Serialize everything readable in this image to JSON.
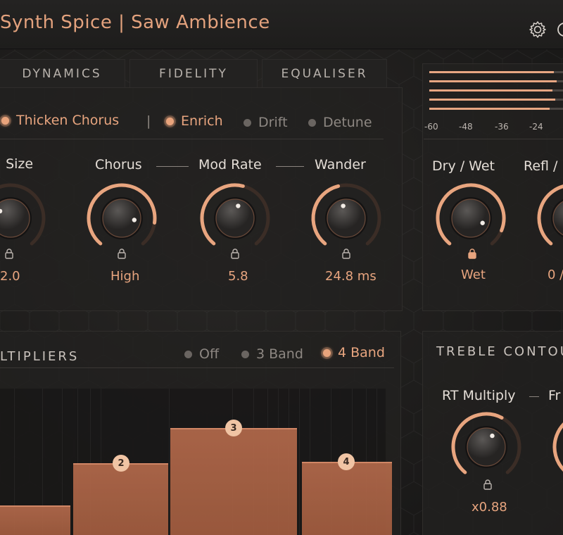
{
  "app": {
    "title": "Synth Spice | Saw Ambience"
  },
  "tabs": [
    {
      "label": "DYNAMICS"
    },
    {
      "label": "FIDELITY"
    },
    {
      "label": "EQUALISER"
    }
  ],
  "modes": {
    "options": [
      {
        "label": "Thicken Chorus",
        "active": true
      },
      {
        "label": "Enrich",
        "active": true
      },
      {
        "label": "Drift",
        "active": false
      },
      {
        "label": "Detune",
        "active": false
      }
    ],
    "separator": "|"
  },
  "controls": [
    {
      "label": ". Size",
      "value": "2.0",
      "level": 0.3
    },
    {
      "label": "Chorus",
      "value": "High",
      "level": 0.85
    },
    {
      "label": "Mod Rate",
      "value": "5.8",
      "level": 0.55
    },
    {
      "label": "Wander",
      "value": "24.8 ms",
      "level": 0.45
    }
  ],
  "connector": "—",
  "meter": {
    "ticks": [
      "-60",
      "-48",
      "-36",
      "-24"
    ],
    "levels": [
      0.93,
      0.95,
      0.92,
      0.94,
      0.9
    ]
  },
  "mix": {
    "controls": [
      {
        "label": "Dry / Wet",
        "value": "Wet",
        "level": 0.9
      },
      {
        "label": "Refl /",
        "value": "0 /",
        "level": 0.5
      }
    ]
  },
  "multipliers": {
    "title": "LTIPLIERS",
    "band_options": [
      {
        "label": "Off",
        "active": false
      },
      {
        "label": "3 Band",
        "active": false
      },
      {
        "label": "4 Band",
        "active": true
      }
    ],
    "bands": [
      {
        "number": "",
        "level": 0.2
      },
      {
        "number": "2",
        "level": 0.49
      },
      {
        "number": "3",
        "level": 0.73
      },
      {
        "number": "4",
        "level": 0.5
      }
    ]
  },
  "treble": {
    "title": "TREBLE CONTOU",
    "controls": [
      {
        "label": "RT Multiply",
        "value": "x0.88",
        "level": 0.6
      },
      {
        "label": "Fr",
        "value": "",
        "level": 0.5
      }
    ]
  },
  "colors": {
    "accent": "#e8a57f",
    "band": "#a85f42",
    "background": "#1d1c1b"
  },
  "icons": {
    "settings": "gear-icon",
    "power": "power-icon",
    "lock": "lock-icon"
  }
}
